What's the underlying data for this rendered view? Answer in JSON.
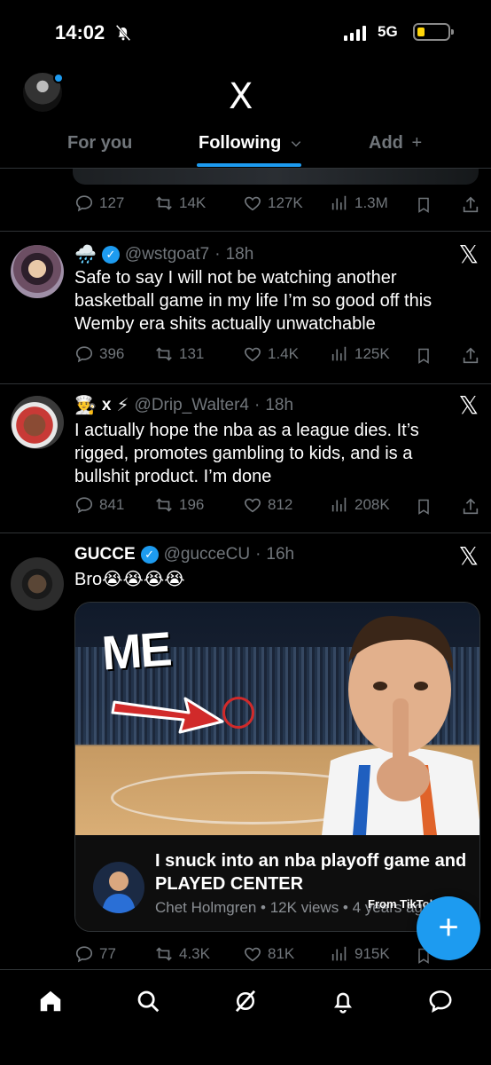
{
  "status_bar": {
    "time": "14:02",
    "network": "5G"
  },
  "header": {
    "logo": "X",
    "tabs": [
      {
        "label": "For you"
      },
      {
        "label": "Following"
      },
      {
        "label": "Add"
      }
    ]
  },
  "previous_tweet": {
    "actions": {
      "replies": "127",
      "reposts": "14K",
      "likes": "127K",
      "views": "1.3M"
    }
  },
  "tweets": [
    {
      "name": "",
      "handle": "@wstgoat7",
      "time": "18h",
      "text": "Safe to say I will not be watching another basketball game in my life I’m so good off this Wemby era shits actually unwatchable",
      "actions": {
        "replies": "396",
        "reposts": "131",
        "likes": "1.4K",
        "views": "125K"
      }
    },
    {
      "name": "x",
      "handle": "@Drip_Walter4",
      "time": "18h",
      "text": "I actually hope the nba as a league dies. It’s rigged, promotes gambling to kids, and is a bullshit product. I’m done",
      "actions": {
        "replies": "841",
        "reposts": "196",
        "likes": "812",
        "views": "208K"
      }
    },
    {
      "name": "GUCCE",
      "handle": "@gucceCU",
      "time": "16h",
      "text": "Bro😭😭😭😭",
      "card": {
        "overlay_text": "ME",
        "title": "I snuck into an nba playoff game and PLAYED CENTER",
        "meta": "Chet Holmgren • 12K views • 4 years ago",
        "from": "From TikTok"
      },
      "actions": {
        "replies": "77",
        "reposts": "4.3K",
        "likes": "81K",
        "views": "915K"
      }
    }
  ],
  "fab": {
    "label": "+"
  },
  "icons": {
    "reply": "reply-icon",
    "repost": "repost-icon",
    "like": "like-icon",
    "views": "views-icon",
    "bookmark": "bookmark-icon",
    "share": "share-icon",
    "home": "home-icon",
    "search": "search-icon",
    "grok": "grok-icon",
    "notifications": "bell-icon",
    "messages": "messages-icon"
  },
  "colors": {
    "accent": "#1d9bf0",
    "muted": "#71767b",
    "background": "#000000"
  }
}
